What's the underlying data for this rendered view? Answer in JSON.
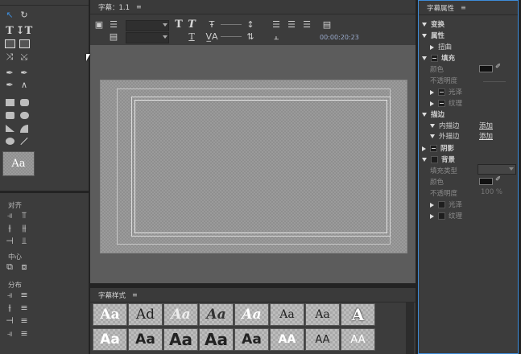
{
  "colors": {
    "accent": "#3d8bd8",
    "panel": "#3c3c3c",
    "canvas_bg": "#5f5f5f"
  },
  "center_panel": {
    "title": "字幕：1.1",
    "menu_icon": "≡",
    "timecode": "00:00:20:23"
  },
  "left_panel": {
    "sample_text": "Aa",
    "align_label": "对齐",
    "center_label": "中心",
    "distribute_label": "分布"
  },
  "styles_panel": {
    "title": "字幕样式",
    "menu_icon": "≡",
    "row1": [
      "Aa",
      "Ad",
      "Aa",
      "Aa",
      "Aa",
      "Aa",
      "Aa"
    ],
    "row2": [
      "Aa",
      "Aa",
      "Aa",
      "Aa",
      "Aa",
      "AA",
      "AA",
      "AA"
    ]
  },
  "right_panel": {
    "title": "字幕属性",
    "menu_icon": "≡",
    "transform": "变换",
    "attributes": "属性",
    "distort": "扭曲",
    "fill": "填充",
    "color": "颜色",
    "opacity": "不透明度",
    "sheen": "光泽",
    "texture": "纹理",
    "stroke": "描边",
    "inner_stroke": "内描边",
    "outer_stroke": "外描边",
    "add": "添加",
    "shadow": "阴影",
    "background": "背景",
    "fill_type": "填充类型",
    "bg_color": "颜色",
    "bg_opacity": "不透明度",
    "bg_opacity_value": "100 %",
    "bg_sheen": "光泽",
    "bg_texture": "纹理"
  }
}
